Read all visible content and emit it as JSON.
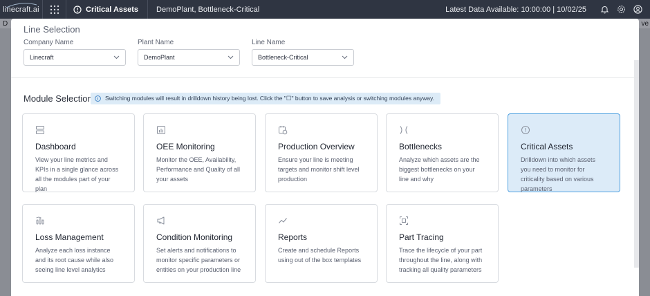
{
  "topbar": {
    "logo": "linecraft.ai",
    "module": "Critical Assets",
    "breadcrumb": "DemoPlant, Bottleneck-Critical",
    "latest_data": "Latest Data Available: 10:00:00 | 10/02/25"
  },
  "background": {
    "edge_right": "ve",
    "edge_left": "D"
  },
  "line_selection": {
    "title": "Line Selection",
    "company": {
      "label": "Company Name",
      "value": "Linecraft"
    },
    "plant": {
      "label": "Plant Name",
      "value": "DemoPlant"
    },
    "line": {
      "label": "Line Name",
      "value": "Bottleneck-Critical"
    }
  },
  "module_selection": {
    "title": "Module Selection",
    "banner": "Switching modules will result in drilldown history being lost. Click the \"☐\" button to save analysis or switching modules anyway.",
    "modules": [
      {
        "title": "Dashboard",
        "desc": "View your line metrics and KPIs in a single glance across all the modules part of your plan",
        "icon": "dashboard-icon"
      },
      {
        "title": "OEE Monitoring",
        "desc": "Monitor the OEE, Availability, Performance and Quality of all your assets",
        "icon": "bar-chart-icon"
      },
      {
        "title": "Production Overview",
        "desc": "Ensure your line is meeting targets and monitor shift level production",
        "icon": "calendar-clock-icon"
      },
      {
        "title": "Bottlenecks",
        "desc": "Analyze which assets are the biggest bottlenecks on your line and why",
        "icon": "bottleneck-icon"
      },
      {
        "title": "Critical Assets",
        "desc": "Drilldown into which assets you need to monitor for criticality based on various parameters",
        "icon": "alert-circle-icon"
      },
      {
        "title": "Loss Management",
        "desc": "Analyze each loss instance and its root cause while also seeing line level analytics",
        "icon": "loss-icon"
      },
      {
        "title": "Condition Monitoring",
        "desc": "Set alerts and notifications to monitor specific parameters or entities on your production line",
        "icon": "megaphone-icon"
      },
      {
        "title": "Reports",
        "desc": "Create and schedule Reports using out of the box templates",
        "icon": "trend-line-icon"
      },
      {
        "title": "Part Tracing",
        "desc": "Trace the lifecycle of your part throughout the line, along with tracking all quality parameters",
        "icon": "scan-icon"
      }
    ]
  },
  "colors": {
    "topbar": "#2f3542",
    "active_card": "#dcebf8",
    "active_border": "#4ea0e0",
    "banner": "#dcebf7"
  }
}
